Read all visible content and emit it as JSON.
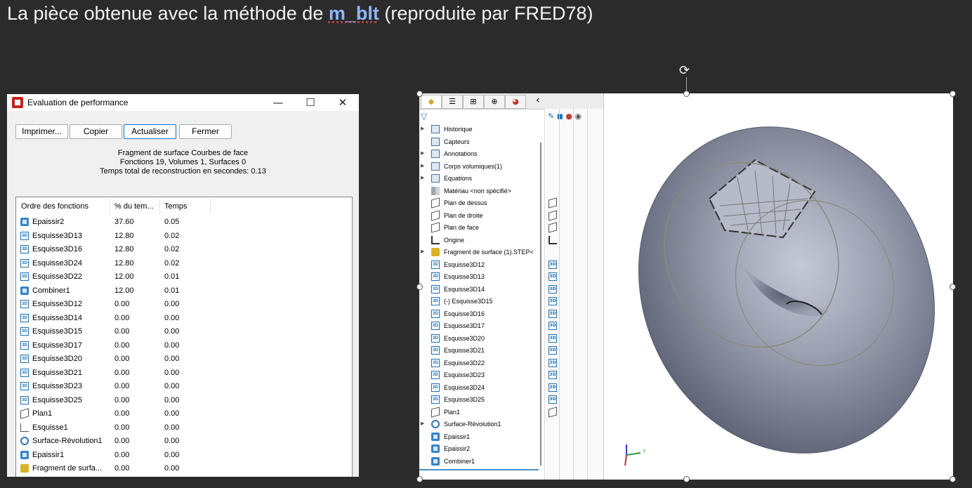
{
  "slide": {
    "title_prefix": "La pièce obtenue avec la méthode de ",
    "title_highlight": "m_blt",
    "title_suffix": " (reproduite par FRED78)"
  },
  "dialog": {
    "title": "Evaluation de performance",
    "window_controls": {
      "minimize": "—",
      "maximize": "☐",
      "close": "✕"
    },
    "buttons": {
      "print": "Imprimer...",
      "copy": "Copier",
      "refresh": "Actualiser",
      "close": "Fermer"
    },
    "summary": {
      "line1": "Fragment de surface Courbes de face",
      "line2": "Fonctions 19, Volumes 1, Surfaces 0",
      "line3": "Temps total de reconstruction en secondes: 0.13"
    },
    "columns": {
      "order": "Ordre des fonctions",
      "percent": "% du tem...",
      "time": "Temps"
    },
    "rows": [
      {
        "icon": "thicken-icon",
        "name": "Epaissir2",
        "percent": "37.60",
        "time": "0.05"
      },
      {
        "icon": "sketch3d-icon",
        "name": "Esquisse3D13",
        "percent": "12.80",
        "time": "0.02"
      },
      {
        "icon": "sketch3d-icon",
        "name": "Esquisse3D16",
        "percent": "12.80",
        "time": "0.02"
      },
      {
        "icon": "sketch3d-icon",
        "name": "Esquisse3D24",
        "percent": "12.80",
        "time": "0.02"
      },
      {
        "icon": "sketch3d-icon",
        "name": "Esquisse3D22",
        "percent": "12.00",
        "time": "0.01"
      },
      {
        "icon": "combine-icon",
        "name": "Combiner1",
        "percent": "12.00",
        "time": "0.01"
      },
      {
        "icon": "sketch3d-icon",
        "name": "Esquisse3D12",
        "percent": "0.00",
        "time": "0.00"
      },
      {
        "icon": "sketch3d-icon",
        "name": "Esquisse3D14",
        "percent": "0.00",
        "time": "0.00"
      },
      {
        "icon": "sketch3d-icon",
        "name": "Esquisse3D15",
        "percent": "0.00",
        "time": "0.00"
      },
      {
        "icon": "sketch3d-icon",
        "name": "Esquisse3D17",
        "percent": "0.00",
        "time": "0.00"
      },
      {
        "icon": "sketch3d-icon",
        "name": "Esquisse3D20",
        "percent": "0.00",
        "time": "0.00"
      },
      {
        "icon": "sketch3d-icon",
        "name": "Esquisse3D21",
        "percent": "0.00",
        "time": "0.00"
      },
      {
        "icon": "sketch3d-icon",
        "name": "Esquisse3D23",
        "percent": "0.00",
        "time": "0.00"
      },
      {
        "icon": "sketch3d-icon",
        "name": "Esquisse3D25",
        "percent": "0.00",
        "time": "0.00"
      },
      {
        "icon": "plane-icon",
        "name": "Plan1",
        "percent": "0.00",
        "time": "0.00"
      },
      {
        "icon": "sketch-icon",
        "name": "Esquisse1",
        "percent": "0.00",
        "time": "0.00"
      },
      {
        "icon": "revolve-surface-icon",
        "name": "Surface-Révolution1",
        "percent": "0.00",
        "time": "0.00"
      },
      {
        "icon": "thicken-icon",
        "name": "Epaissir1",
        "percent": "0.00",
        "time": "0.00"
      },
      {
        "icon": "imported-surface-icon",
        "name": "Fragment de surfa...",
        "percent": "0.00",
        "time": "0.00"
      }
    ]
  },
  "feature_manager": {
    "tab_collapse": "‹",
    "items": [
      {
        "icon": "history-icon",
        "label": "Historique",
        "expandable": true
      },
      {
        "icon": "sensors-icon",
        "label": "Capteurs",
        "expandable": false
      },
      {
        "icon": "annotations-icon",
        "label": "Annotations",
        "expandable": true
      },
      {
        "icon": "solid-bodies-icon",
        "label": "Corps volumiques(1)",
        "expandable": true
      },
      {
        "icon": "equations-icon",
        "label": "Equations",
        "expandable": true
      },
      {
        "icon": "material-icon",
        "label": "Matériau <non spécifié>",
        "expandable": false
      },
      {
        "icon": "plane-icon",
        "label": "Plan de dessus",
        "expandable": false
      },
      {
        "icon": "plane-icon",
        "label": "Plan de droite",
        "expandable": false
      },
      {
        "icon": "plane-icon",
        "label": "Plan de face",
        "expandable": false
      },
      {
        "icon": "origin-icon",
        "label": "Origine",
        "expandable": false
      },
      {
        "icon": "imported-surface-icon",
        "label": "Fragment de surface (1).STEP<",
        "expandable": true
      },
      {
        "icon": "sketch3d-icon",
        "label": "Esquisse3D12",
        "expandable": false
      },
      {
        "icon": "sketch3d-icon",
        "label": "Esquisse3D13",
        "expandable": false
      },
      {
        "icon": "sketch3d-icon",
        "label": "Esquisse3D14",
        "expandable": false
      },
      {
        "icon": "sketch3d-icon",
        "label": "(-) Esquisse3D15",
        "expandable": false
      },
      {
        "icon": "sketch3d-icon",
        "label": "Esquisse3D16",
        "expandable": false
      },
      {
        "icon": "sketch3d-icon",
        "label": "Esquisse3D17",
        "expandable": false
      },
      {
        "icon": "sketch3d-icon",
        "label": "Esquisse3D20",
        "expandable": false
      },
      {
        "icon": "sketch3d-icon",
        "label": "Esquisse3D21",
        "expandable": false
      },
      {
        "icon": "sketch3d-icon",
        "label": "Esquisse3D22",
        "expandable": false
      },
      {
        "icon": "sketch3d-icon",
        "label": "Esquisse3D23",
        "expandable": false
      },
      {
        "icon": "sketch3d-icon",
        "label": "Esquisse3D24",
        "expandable": false
      },
      {
        "icon": "sketch3d-icon",
        "label": "Esquisse3D25",
        "expandable": false
      },
      {
        "icon": "plane-icon",
        "label": "Plan1",
        "expandable": false
      },
      {
        "icon": "revolve-surface-icon",
        "label": "Surface-Révolution1",
        "expandable": true
      },
      {
        "icon": "thicken-icon",
        "label": "Epaissir1",
        "expandable": false
      },
      {
        "icon": "thicken-icon",
        "label": "Epaissir2",
        "expandable": false
      },
      {
        "icon": "combine-icon",
        "label": "Combiner1",
        "expandable": false
      }
    ]
  },
  "model_view": {
    "triad_y_label": "Y",
    "part_color": "#8a8fa0"
  },
  "colors": {
    "background": "#2b2b2b",
    "title_highlight": "#8fb4ff",
    "accent": "#0078d7"
  }
}
